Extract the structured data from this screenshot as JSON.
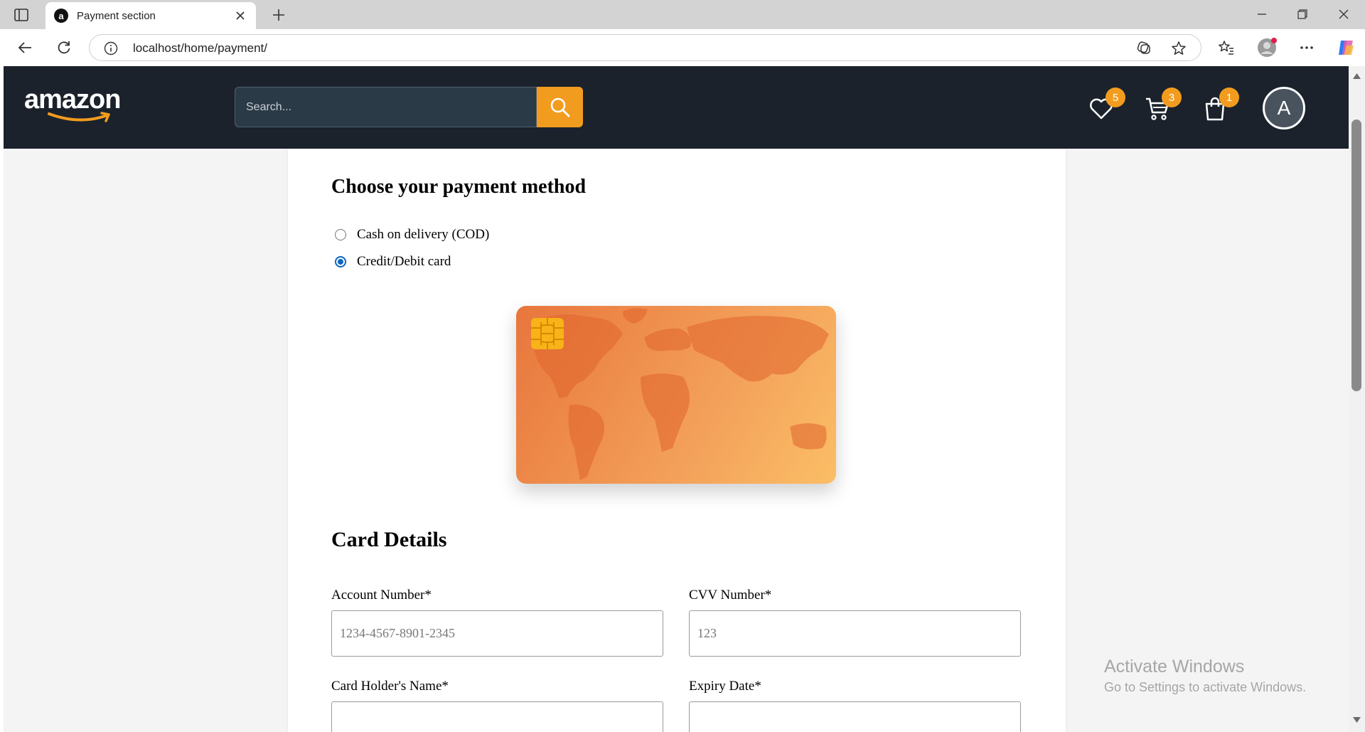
{
  "browser": {
    "tab_title": "Payment section",
    "tab_favicon_letter": "a",
    "url": "localhost/home/payment/"
  },
  "header": {
    "logo_text": "amazon",
    "search_placeholder": "Search...",
    "wishlist_count": "5",
    "cart_count": "3",
    "orders_count": "1",
    "avatar_initial": "A",
    "accent_color": "#f29c1f"
  },
  "payment": {
    "title": "Choose your payment method",
    "options": [
      {
        "label": "Cash on delivery (COD)",
        "selected": false
      },
      {
        "label": "Credit/Debit card",
        "selected": true
      }
    ]
  },
  "card_details": {
    "title": "Card Details",
    "account_number_label": "Account Number*",
    "account_number_placeholder": "1234-4567-8901-2345",
    "cvv_label": "CVV Number*",
    "cvv_placeholder": "123",
    "holder_label": "Card Holder's Name*",
    "expiry_label": "Expiry Date*"
  },
  "watermark": {
    "line1": "Activate Windows",
    "line2": "Go to Settings to activate Windows."
  }
}
